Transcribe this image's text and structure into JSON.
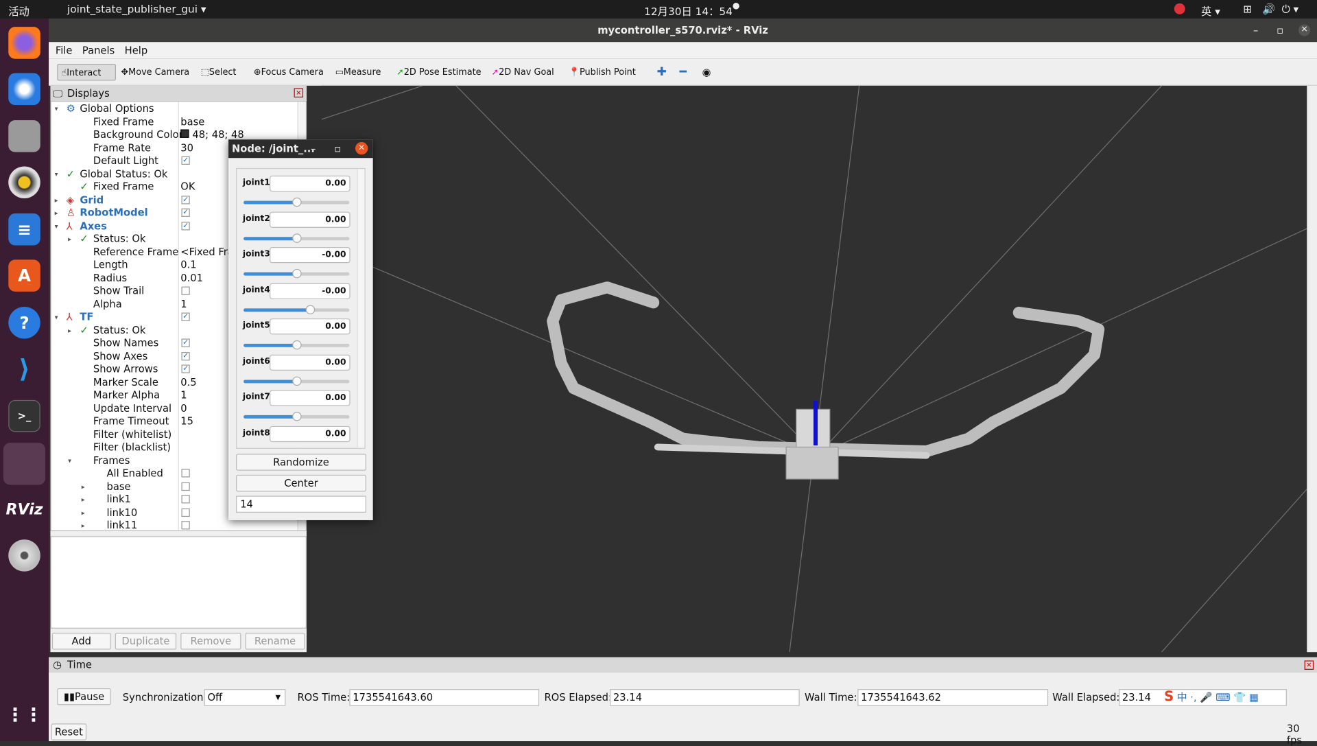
{
  "topbar": {
    "activities": "活动",
    "app_menu": "joint_state_publisher_gui ▾",
    "clock": "12月30日 14：54",
    "dot": "●",
    "lang": "英 ▾"
  },
  "dock": {
    "items": [
      "firefox",
      "thunderbird",
      "files",
      "rhythmbox",
      "writer",
      "app-center",
      "help",
      "vscode",
      "terminal",
      "blank",
      "rviz",
      "dvd",
      "app-grid"
    ],
    "rviz_label": "RViz"
  },
  "window": {
    "title": "mycontroller_s570.rviz* - RViz"
  },
  "menu": {
    "items": [
      "File",
      "Panels",
      "Help"
    ]
  },
  "toolbar": {
    "items": [
      "Interact",
      "Move Camera",
      "Select",
      "Focus Camera",
      "Measure",
      "2D Pose Estimate",
      "2D Nav Goal",
      "Publish Point"
    ]
  },
  "displays": {
    "title": "Displays",
    "rows": [
      {
        "indent": 0,
        "arrow": "▾",
        "icon": "⚙",
        "label": "Global Options",
        "value": ""
      },
      {
        "indent": 1,
        "label": "Fixed Frame",
        "value": "base"
      },
      {
        "indent": 1,
        "label": "Background Color",
        "value": "48; 48; 48",
        "swatch": "#303030"
      },
      {
        "indent": 1,
        "label": "Frame Rate",
        "value": "30"
      },
      {
        "indent": 1,
        "label": "Default Light",
        "check": true
      },
      {
        "indent": 0,
        "arrow": "▾",
        "icon": "✓",
        "label": "Global Status: Ok",
        "value": ""
      },
      {
        "indent": 1,
        "icon": "✓",
        "label": "Fixed Frame",
        "value": "OK"
      },
      {
        "indent": 0,
        "arrow": "▸",
        "icon": "◈",
        "label": "Grid",
        "bold": true,
        "check": true
      },
      {
        "indent": 0,
        "arrow": "▸",
        "icon": "♙",
        "label": "RobotModel",
        "bold": true,
        "check": true
      },
      {
        "indent": 0,
        "arrow": "▾",
        "icon": "⅄",
        "label": "Axes",
        "bold": true,
        "check": true
      },
      {
        "indent": 1,
        "arrow": "▸",
        "icon": "✓",
        "label": "Status: Ok",
        "value": ""
      },
      {
        "indent": 1,
        "label": "Reference Frame",
        "value": "<Fixed Frame>"
      },
      {
        "indent": 1,
        "label": "Length",
        "value": "0.1"
      },
      {
        "indent": 1,
        "label": "Radius",
        "value": "0.01"
      },
      {
        "indent": 1,
        "label": "Show Trail",
        "check": false
      },
      {
        "indent": 1,
        "label": "Alpha",
        "value": "1"
      },
      {
        "indent": 0,
        "arrow": "▾",
        "icon": "⅄",
        "label": "TF",
        "bold": true,
        "check": true
      },
      {
        "indent": 1,
        "arrow": "▸",
        "icon": "✓",
        "label": "Status: Ok",
        "value": ""
      },
      {
        "indent": 1,
        "label": "Show Names",
        "check": true
      },
      {
        "indent": 1,
        "label": "Show Axes",
        "check": true
      },
      {
        "indent": 1,
        "label": "Show Arrows",
        "check": true
      },
      {
        "indent": 1,
        "label": "Marker Scale",
        "value": "0.5"
      },
      {
        "indent": 1,
        "label": "Marker Alpha",
        "value": "1"
      },
      {
        "indent": 1,
        "label": "Update Interval",
        "value": "0"
      },
      {
        "indent": 1,
        "label": "Frame Timeout",
        "value": "15"
      },
      {
        "indent": 1,
        "label": "Filter (whitelist)",
        "value": ""
      },
      {
        "indent": 1,
        "label": "Filter (blacklist)",
        "value": ""
      },
      {
        "indent": 1,
        "arrow": "▾",
        "label": "Frames",
        "value": ""
      },
      {
        "indent": 2,
        "label": "All Enabled",
        "check": false
      },
      {
        "indent": 2,
        "arrow": "▸",
        "label": "base",
        "check": false
      },
      {
        "indent": 2,
        "arrow": "▸",
        "label": "link1",
        "check": false
      },
      {
        "indent": 2,
        "arrow": "▸",
        "label": "link10",
        "check": false
      },
      {
        "indent": 2,
        "arrow": "▸",
        "label": "link11",
        "check": false
      }
    ],
    "buttons": {
      "add": "Add",
      "duplicate": "Duplicate",
      "remove": "Remove",
      "rename": "Rename"
    }
  },
  "dialog": {
    "title": "Node: /joint_...",
    "joints": [
      {
        "name": "joint1",
        "value": "0.00",
        "fraction": 0.5
      },
      {
        "name": "joint2",
        "value": "0.00",
        "fraction": 0.5
      },
      {
        "name": "joint3",
        "value": "-0.00",
        "fraction": 0.5
      },
      {
        "name": "joint4",
        "value": "-0.00",
        "fraction": 0.63
      },
      {
        "name": "joint5",
        "value": "0.00",
        "fraction": 0.5
      },
      {
        "name": "joint6",
        "value": "0.00",
        "fraction": 0.5
      },
      {
        "name": "joint7",
        "value": "0.00",
        "fraction": 0.5
      },
      {
        "name": "joint8",
        "value": "0.00",
        "fraction": 0.5
      }
    ],
    "randomize": "Randomize",
    "center": "Center",
    "spin_value": "14"
  },
  "time": {
    "title": "Time",
    "pause": "Pause",
    "sync_label": "Synchronization:",
    "sync_value": "Off",
    "ros_time_label": "ROS Time:",
    "ros_time": "1735541643.60",
    "ros_elapsed_label": "ROS Elapsed:",
    "ros_elapsed": "23.14",
    "wall_time_label": "Wall Time:",
    "wall_time": "1735541643.62",
    "wall_elapsed_label": "Wall Elapsed:",
    "wall_elapsed": "23.14",
    "reset": "Reset",
    "fps": "30 fps"
  },
  "colors": {
    "background": "#303030",
    "accent": "#2a6fb8",
    "dock": "#3b1d33"
  }
}
